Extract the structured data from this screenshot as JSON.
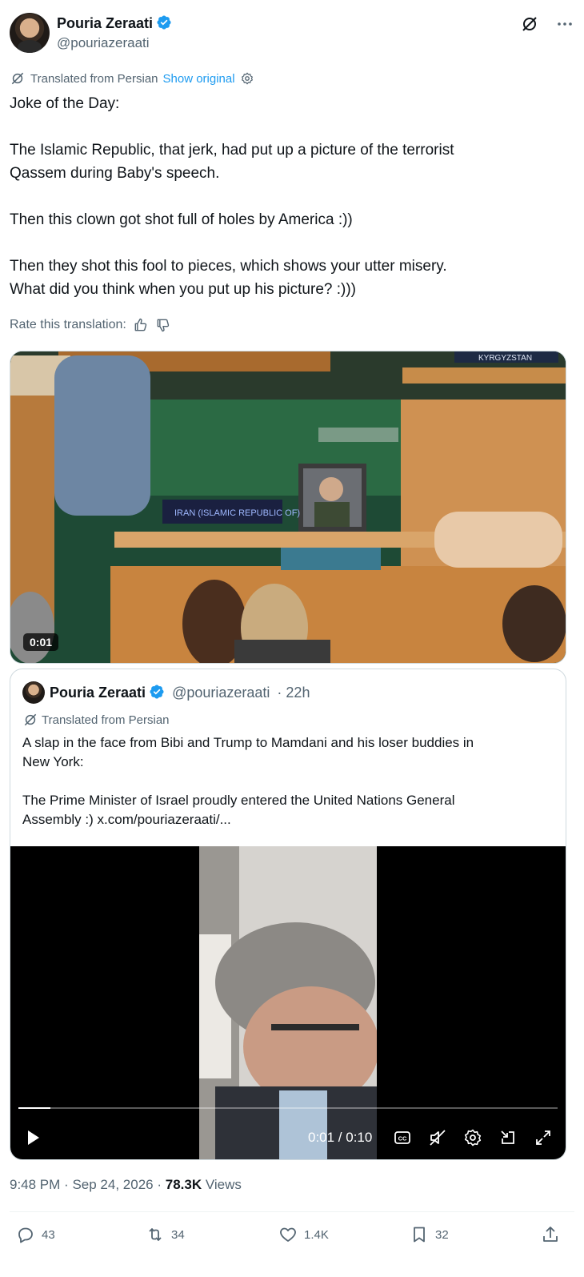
{
  "author": {
    "name": "Pouria Zeraati",
    "handle": "@pouriazeraati"
  },
  "translation": {
    "label": "Translated from Persian",
    "show_original": "Show original",
    "rate_label": "Rate this translation:"
  },
  "tweet": {
    "line1": "Joke of the Day:",
    "line2": "The Islamic Republic, that jerk, had put up a picture of the terrorist",
    "line3": "Qassem during Baby's speech.",
    "line4": "Then this clown got shot full of holes by America :))",
    "line5": "Then they shot this fool to pieces, which shows your utter misery.",
    "line6": "What did you think when you put up his picture? :)))"
  },
  "media": {
    "duration": "0:01",
    "placard_text": "IRAN (ISLAMIC REPUBLIC OF)",
    "top_sign_text": "KYRGYZSTAN"
  },
  "quote": {
    "name": "Pouria Zeraati",
    "handle": "@pouriazeraati",
    "time": "· 22h",
    "translated_label": "Translated from Persian",
    "line1": "A slap in the face from Bibi and Trump to Mamdani and his loser buddies in",
    "line2": "New York:",
    "line3": "The Prime Minister of Israel proudly entered the United Nations General",
    "line4": "Assembly :) x.com/pouriazeraati/...",
    "video": {
      "time_readout": "0:01 / 0:10",
      "progress": 0.06
    }
  },
  "meta": {
    "time": "9:48 PM",
    "date": "Sep 24, 2026",
    "sep": "·",
    "views_count": "78.3K",
    "views_label": "Views"
  },
  "actions": {
    "replies": "43",
    "reposts": "34",
    "likes": "1.4K",
    "bookmarks": "32"
  },
  "colors": {
    "accent": "#1d9bf0",
    "secondary_text": "#536471",
    "primary_text": "#0f1419"
  }
}
